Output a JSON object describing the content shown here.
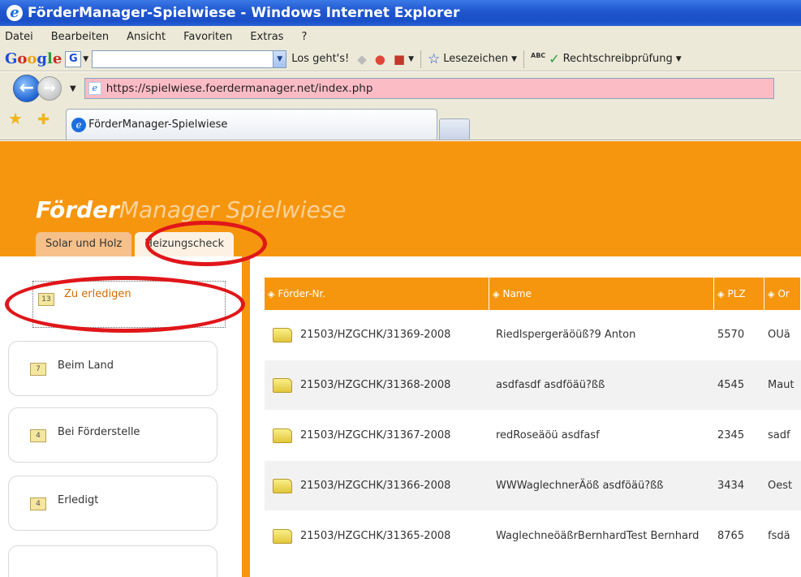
{
  "window": {
    "title": "FörderManager-Spielwiese - Windows Internet Explorer"
  },
  "menu": [
    "Datei",
    "Bearbeiten",
    "Ansicht",
    "Favoriten",
    "Extras",
    "?"
  ],
  "google_toolbar": {
    "search_value": "",
    "go_label": "Los geht's!",
    "bookmarks_label": "Lesezeichen",
    "spell_label": "Rechtschreibprüfung"
  },
  "address": {
    "url": "https://spielwiese.foerdermanager.net/index.php"
  },
  "browser_tab": {
    "label": "FörderManager-Spielwiese"
  },
  "app": {
    "brand_bold": "Förder",
    "brand_rest": "Manager Spielwiese",
    "tabs": [
      "Solar und Holz",
      "Heizungscheck"
    ]
  },
  "buckets": [
    {
      "count": "13",
      "label": "Zu erledigen"
    },
    {
      "count": "7",
      "label": "Beim Land"
    },
    {
      "count": "4",
      "label": "Bei Förderstelle"
    },
    {
      "count": "4",
      "label": "Erledigt"
    }
  ],
  "grid": {
    "columns": [
      "Förder-Nr.",
      "Name",
      "PLZ",
      "Or"
    ],
    "rows": [
      {
        "nr": "21503/HZGCHK/31369-2008",
        "name": "Riedlspergeräöüß?9 Anton",
        "plz": "5570",
        "ort": "ÖÜä"
      },
      {
        "nr": "21503/HZGCHK/31368-2008",
        "name": "asdfasdf asdföäü?ßß",
        "plz": "4545",
        "ort": "Maut"
      },
      {
        "nr": "21503/HZGCHK/31367-2008",
        "name": "redRoseäöü asdfasf",
        "plz": "2345",
        "ort": "sadf"
      },
      {
        "nr": "21503/HZGCHK/31366-2008",
        "name": "WWWaglechnerÄöß asdföäü?ßß",
        "plz": "3434",
        "ort": "Oest"
      },
      {
        "nr": "21503/HZGCHK/31365-2008",
        "name": "WaglechneöäßrBernhardTest Bernhard",
        "plz": "8765",
        "ort": "fsdä"
      }
    ]
  },
  "colors": {
    "accent": "#f6960f",
    "annotation": "#e0161a",
    "url_bg": "#fcbcc6"
  }
}
